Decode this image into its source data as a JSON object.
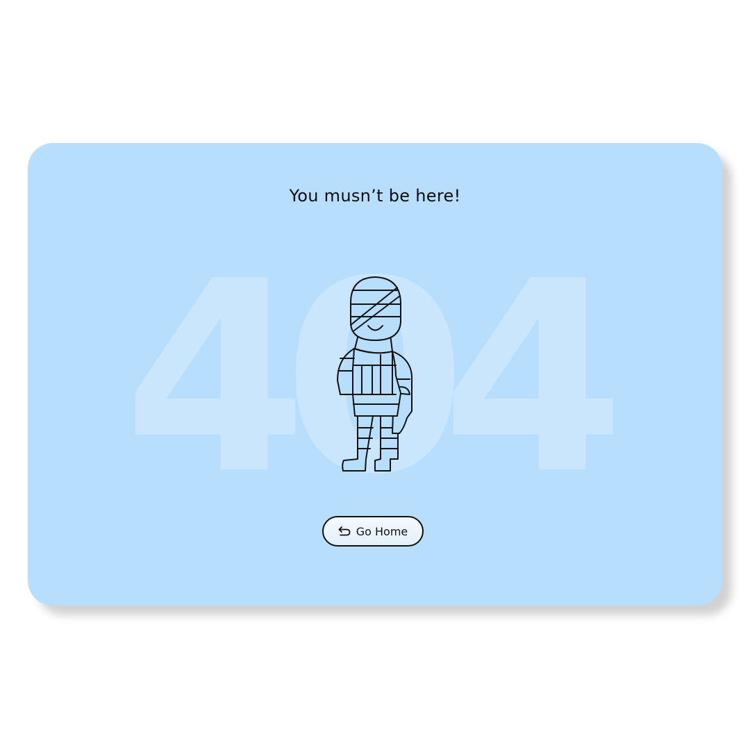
{
  "card": {
    "title": "You musn’t be here!",
    "background_color": "#b7dffd"
  },
  "error_code": {
    "digits": [
      "4",
      "0",
      "4"
    ],
    "color": "#c9e6fd"
  },
  "illustration": {
    "name": "bandaged-mummy",
    "stroke_color": "#111111"
  },
  "home_button": {
    "label": "Go Home",
    "icon": "return-arrow-icon"
  }
}
